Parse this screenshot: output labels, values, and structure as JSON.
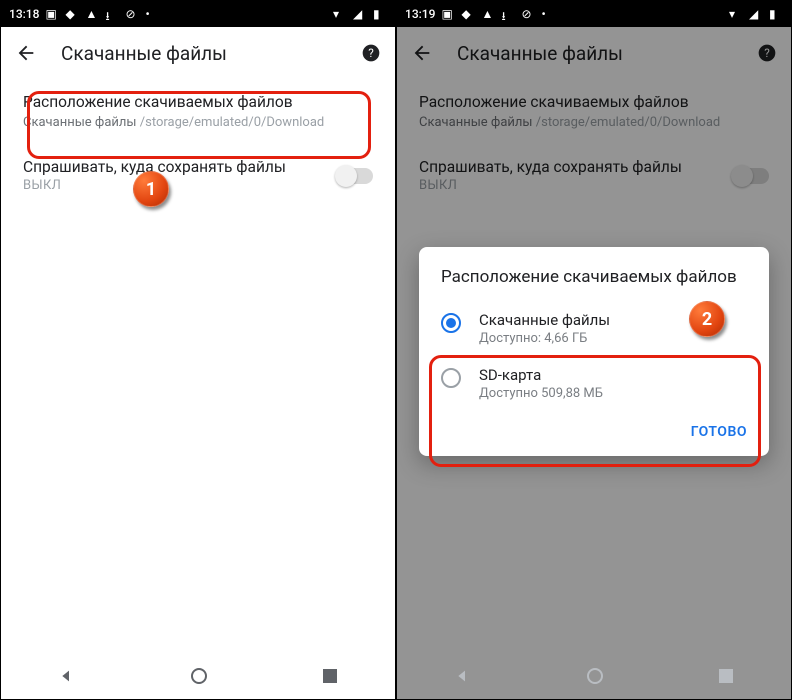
{
  "left": {
    "status_time": "13:18",
    "title": "Скачанные файлы",
    "pref_location_title": "Расположение скачиваемых файлов",
    "pref_location_label": "Скачанные файлы",
    "pref_location_path": "/storage/emulated/0/Download",
    "pref_ask_title": "Спрашивать, куда сохранять файлы",
    "pref_ask_state": "ВЫКЛ"
  },
  "right": {
    "status_time": "13:19",
    "title": "Скачанные файлы",
    "pref_location_title": "Расположение скачиваемых файлов",
    "pref_location_label": "Скачанные файлы",
    "pref_location_path": "/storage/emulated/0/Download",
    "pref_ask_title": "Спрашивать, куда сохранять файлы",
    "pref_ask_state": "ВЫКЛ",
    "dialog": {
      "title": "Расположение скачиваемых файлов",
      "opt1_title": "Скачанные файлы",
      "opt1_sub": "Доступно: 4,66 ГБ",
      "opt2_title": "SD-карта",
      "opt2_sub": "Доступно 509,88 МБ",
      "done": "ГОТОВО"
    }
  },
  "badges": {
    "one": "1",
    "two": "2"
  }
}
